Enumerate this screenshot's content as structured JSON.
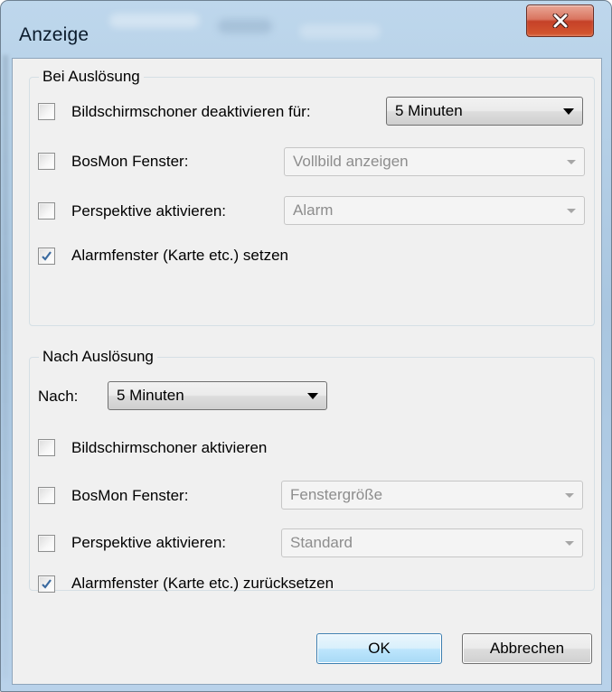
{
  "window": {
    "title": "Anzeige",
    "close_icon": "close-x-icon"
  },
  "colors": {
    "close_button": "#c54128",
    "default_button_border": "#3c7fb1",
    "disabled_text": "#8d8d8d"
  },
  "group_bei": {
    "title": "Bei Auslösung",
    "rows": [
      {
        "label": "Bildschirmschoner deaktivieren für:",
        "checked": false,
        "dropdown": {
          "value": "5 Minuten",
          "enabled": true
        }
      },
      {
        "label": "BosMon Fenster:",
        "checked": false,
        "dropdown": {
          "value": "Vollbild anzeigen",
          "enabled": false
        }
      },
      {
        "label": "Perspektive aktivieren:",
        "checked": false,
        "dropdown": {
          "value": "Alarm",
          "enabled": false
        }
      },
      {
        "label": "Alarmfenster (Karte etc.) setzen",
        "checked": true
      }
    ]
  },
  "group_nach": {
    "title": "Nach Auslösung",
    "after_label": "Nach:",
    "after_value": "5 Minuten",
    "rows": [
      {
        "label": "Bildschirmschoner aktivieren",
        "checked": false
      },
      {
        "label": "BosMon Fenster:",
        "checked": false,
        "dropdown": {
          "value": "Fenstergröße",
          "enabled": false
        }
      },
      {
        "label": "Perspektive aktivieren:",
        "checked": false,
        "dropdown": {
          "value": "Standard",
          "enabled": false
        }
      },
      {
        "label": "Alarmfenster (Karte etc.) zurücksetzen",
        "checked": true
      }
    ]
  },
  "buttons": {
    "ok": "OK",
    "cancel": "Abbrechen"
  }
}
